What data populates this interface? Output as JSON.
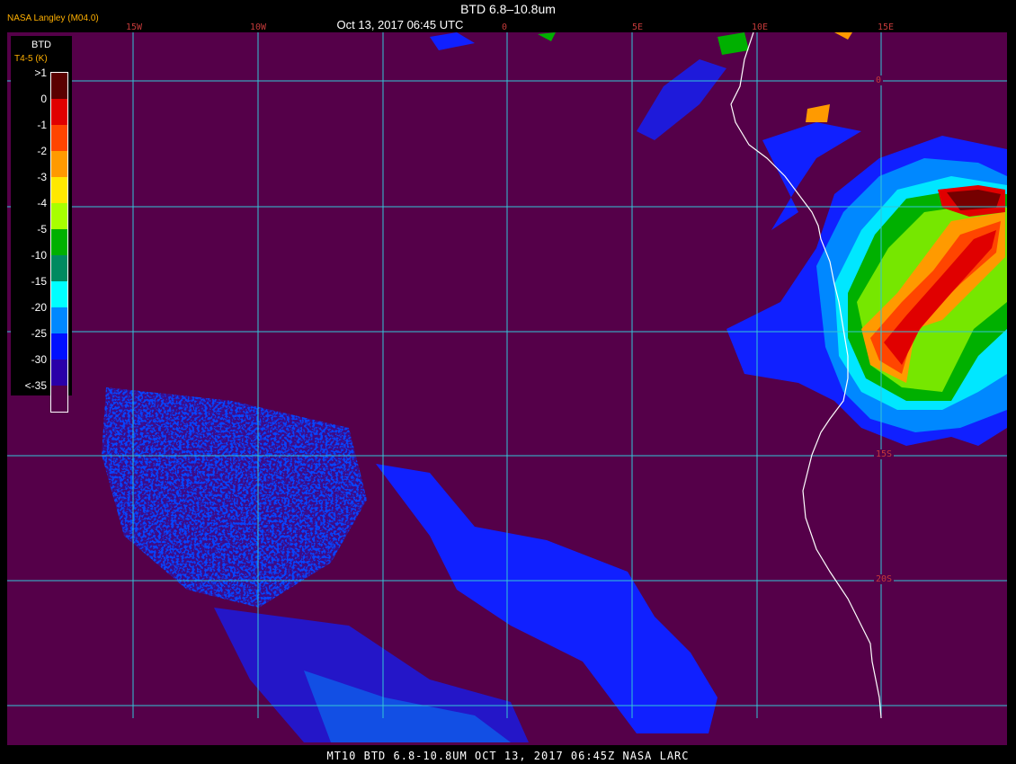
{
  "header": {
    "title": "BTD 6.8–10.8um",
    "datetime": "Oct 13, 2017 06:45 UTC",
    "producer": "NASA Langley (M04.0)"
  },
  "longitude_labels": [
    "15W",
    "10W",
    "0",
    "5E",
    "10E",
    "15E"
  ],
  "latitude_labels": [
    "0",
    "15S",
    "20S"
  ],
  "legend": {
    "title": "BTD",
    "units": "T4-5 (K)",
    "labels": [
      ">1",
      "0",
      "-1",
      "-2",
      "-3",
      "-4",
      "-5",
      "-10",
      "-15",
      "-20",
      "-25",
      "-30",
      "<-35"
    ],
    "colors": [
      "#5a0000",
      "#e00000",
      "#ff4500",
      "#ff9a00",
      "#ffe800",
      "#a8ff00",
      "#00b000",
      "#008a60",
      "#00ffff",
      "#0088ff",
      "#0010ff",
      "#2a00a8",
      "#550049"
    ]
  },
  "background_color": "#550049",
  "grid_color": "#33c6d6",
  "coastline_color": "#ffffff",
  "footer": "MT10  BTD 6.8-10.8UM  OCT 13, 2017 06:45Z  NASA LARC"
}
